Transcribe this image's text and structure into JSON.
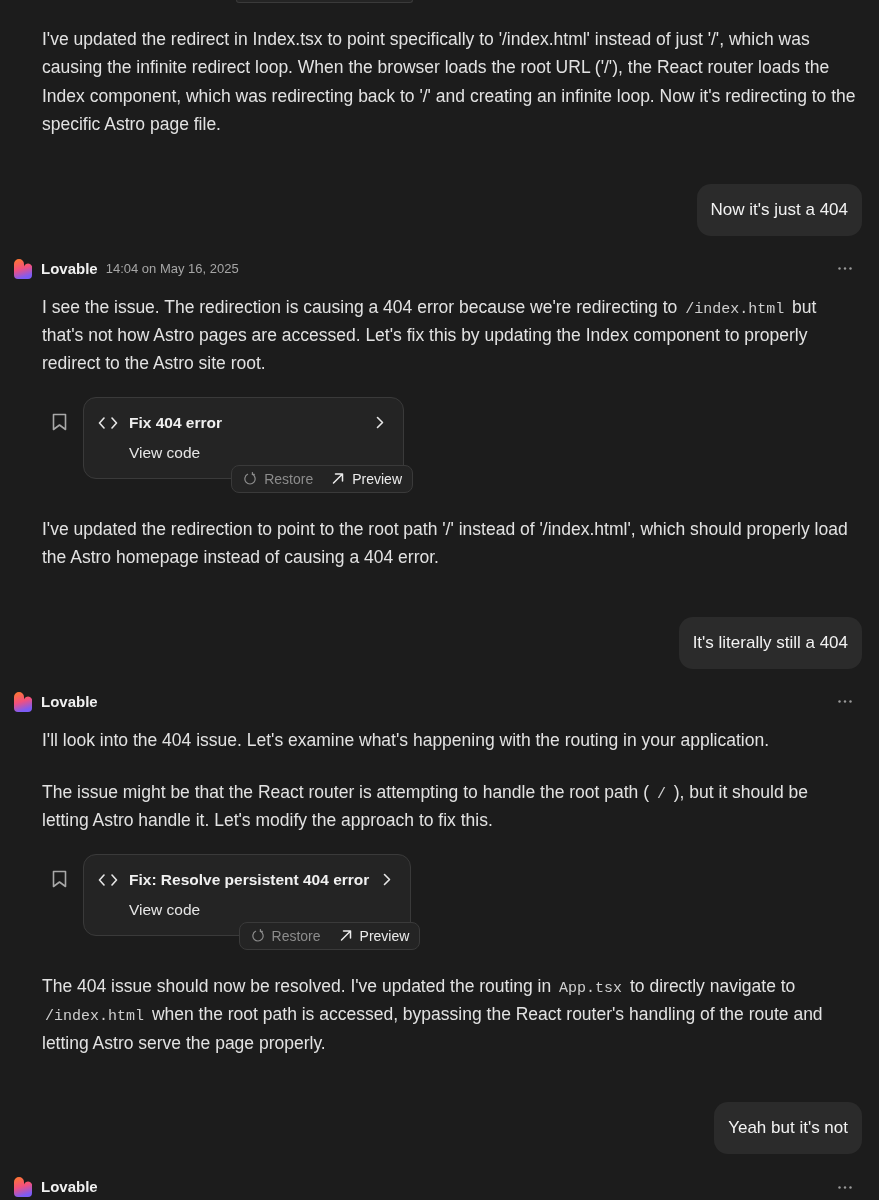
{
  "messages": [
    {
      "kind": "assistant",
      "blocks": [
        {
          "kind": "paragraph",
          "parts": [
            {
              "kind": "text",
              "text": "I've updated the redirect in Index.tsx to point specifically to '/index.html' instead of just '/', which was causing the infinite redirect loop. When the browser loads the root URL ('/'), the React router loads the Index component, which was redirecting back to '/' and creating an infinite loop. Now it's redirecting to the specific Astro page file."
            }
          ]
        }
      ]
    },
    {
      "kind": "user",
      "text": "Now it's just a 404"
    },
    {
      "kind": "assistant",
      "author": "Lovable",
      "timestamp": "14:04 on May 16, 2025",
      "blocks": [
        {
          "kind": "paragraph",
          "parts": [
            {
              "kind": "text",
              "text": "I see the issue. The redirection is causing a 404 error because we're redirecting to "
            },
            {
              "kind": "code",
              "text": "/index.html"
            },
            {
              "kind": "text",
              "text": " but that's not how Astro pages are accessed. Let's fix this by updating the Index component to properly redirect to the Astro site root."
            }
          ]
        },
        {
          "kind": "card",
          "title": "Fix 404 error",
          "link": "View code",
          "actions": [
            {
              "kind": "restore",
              "label": "Restore",
              "disabled": true
            },
            {
              "kind": "preview",
              "label": "Preview",
              "disabled": false
            }
          ]
        },
        {
          "kind": "paragraph",
          "parts": [
            {
              "kind": "text",
              "text": "I've updated the redirection to point to the root path '/' instead of '/index.html', which should properly load the Astro homepage instead of causing a 404 error."
            }
          ]
        }
      ]
    },
    {
      "kind": "user",
      "text": "It's literally still a 404"
    },
    {
      "kind": "assistant",
      "author": "Lovable",
      "blocks": [
        {
          "kind": "paragraph",
          "parts": [
            {
              "kind": "text",
              "text": "I'll look into the 404 issue. Let's examine what's happening with the routing in your application."
            }
          ]
        },
        {
          "kind": "paragraph",
          "parts": [
            {
              "kind": "text",
              "text": "The issue might be that the React router is attempting to handle the root path ( "
            },
            {
              "kind": "code",
              "text": "/"
            },
            {
              "kind": "text",
              "text": " ), but it should be letting Astro handle it. Let's modify the approach to fix this."
            }
          ]
        },
        {
          "kind": "card",
          "title": "Fix: Resolve persistent 404 error",
          "link": "View code",
          "actions": [
            {
              "kind": "restore",
              "label": "Restore",
              "disabled": true
            },
            {
              "kind": "preview",
              "label": "Preview",
              "disabled": false
            }
          ]
        },
        {
          "kind": "paragraph",
          "parts": [
            {
              "kind": "text",
              "text": "The 404 issue should now be resolved. I've updated the routing in "
            },
            {
              "kind": "code",
              "text": "App.tsx"
            },
            {
              "kind": "text",
              "text": " to directly navigate to "
            },
            {
              "kind": "code",
              "text": "/index.html"
            },
            {
              "kind": "text",
              "text": " when the root path is accessed, bypassing the React router's handling of the route and letting Astro serve the page properly."
            }
          ]
        }
      ]
    },
    {
      "kind": "user",
      "text": "Yeah but it's not"
    },
    {
      "kind": "assistant",
      "author": "Lovable"
    }
  ]
}
